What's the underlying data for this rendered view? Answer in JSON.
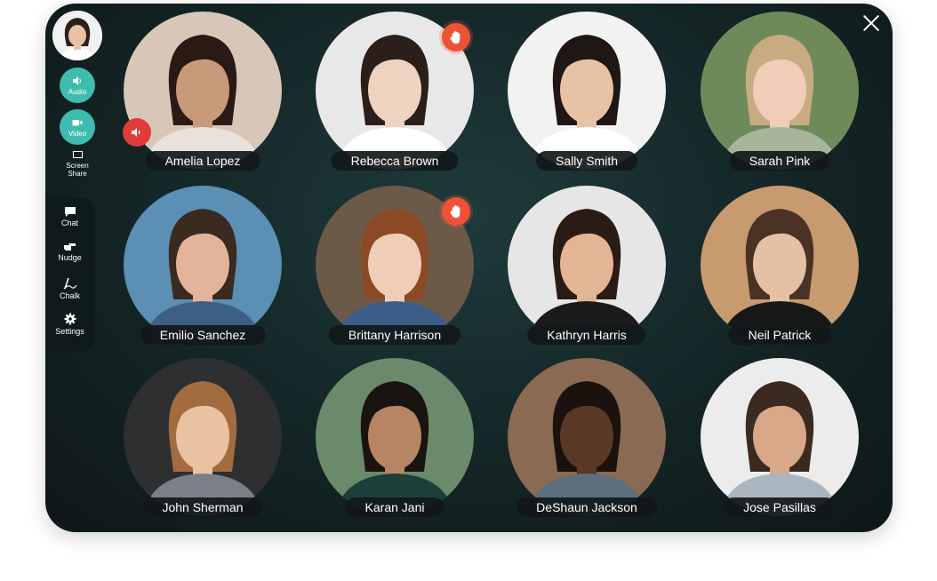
{
  "sidebar": {
    "audio_label": "Audio",
    "video_label": "Video",
    "screen_share_label": "Screen\nShare",
    "chat_label": "Chat",
    "nudge_label": "Nudge",
    "chalk_label": "Chalk",
    "settings_label": "Settings",
    "accent_color": "#3fbcb0"
  },
  "participants": [
    {
      "name": "Amelia Lopez",
      "bg": "#d8c7b8",
      "skin": "#c99a7a",
      "hair": "#2b1a14",
      "shirt": "#e9e2dc",
      "muted": true,
      "hand_raised": false
    },
    {
      "name": "Rebecca Brown",
      "bg": "#e8e8e8",
      "skin": "#f0d2c0",
      "hair": "#2a1f1a",
      "shirt": "#ffffff",
      "muted": false,
      "hand_raised": true
    },
    {
      "name": "Sally Smith",
      "bg": "#f2f2f2",
      "skin": "#e8c2a6",
      "hair": "#1e1714",
      "shirt": "#ffffff",
      "muted": false,
      "hand_raised": false
    },
    {
      "name": "Sarah Pink",
      "bg": "#6f8a5a",
      "skin": "#f0cdb8",
      "hair": "#c9ab82",
      "shirt": "#a7b59a",
      "muted": false,
      "hand_raised": false
    },
    {
      "name": "Emilio Sanchez",
      "bg": "#5b8fb3",
      "skin": "#e2b49a",
      "hair": "#3a2a1f",
      "shirt": "#3d5f86",
      "muted": false,
      "hand_raised": false
    },
    {
      "name": "Brittany Harrison",
      "bg": "#6b5a48",
      "skin": "#f0cdb6",
      "hair": "#8b4a25",
      "shirt": "#3b5d88",
      "muted": false,
      "hand_raised": true
    },
    {
      "name": "Kathryn Harris",
      "bg": "#e6e6e6",
      "skin": "#e3b595",
      "hair": "#2a1b14",
      "shirt": "#1b1b1b",
      "muted": false,
      "hand_raised": false
    },
    {
      "name": "Neil Patrick",
      "bg": "#c79a70",
      "skin": "#e5c0a4",
      "hair": "#4a3324",
      "shirt": "#171717",
      "muted": false,
      "hand_raised": false
    },
    {
      "name": "John Sherman",
      "bg": "#2e2f31",
      "skin": "#e9c2a2",
      "hair": "#a36c3f",
      "shirt": "#7b7f88",
      "muted": false,
      "hand_raised": false
    },
    {
      "name": "Karan Jani",
      "bg": "#6b8a6c",
      "skin": "#b78563",
      "hair": "#1a1411",
      "shirt": "#1c3f3a",
      "muted": false,
      "hand_raised": false
    },
    {
      "name": "DeShaun Jackson",
      "bg": "#8a6a52",
      "skin": "#5a3826",
      "hair": "#1b120d",
      "shirt": "#5c6f7e",
      "muted": false,
      "hand_raised": false
    },
    {
      "name": "Jose Pasillas",
      "bg": "#ececec",
      "skin": "#d9a888",
      "hair": "#3b2a1f",
      "shirt": "#a9b6c0",
      "muted": false,
      "hand_raised": false
    }
  ]
}
